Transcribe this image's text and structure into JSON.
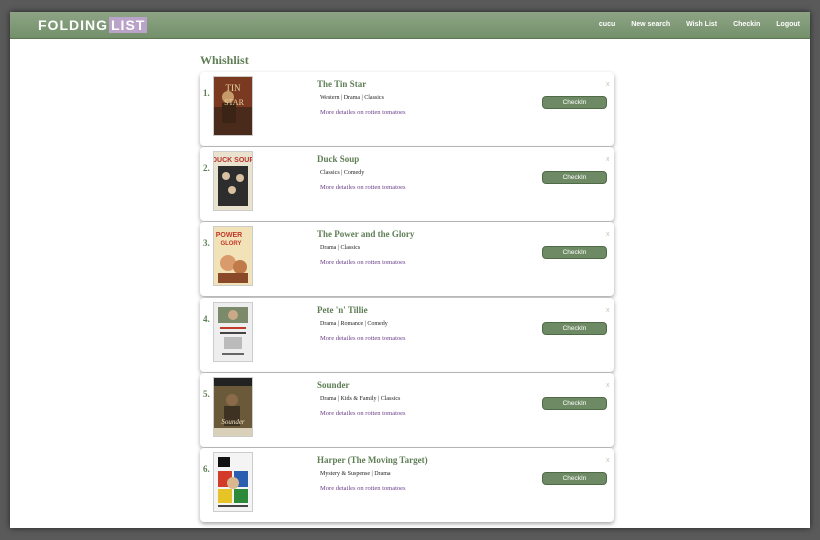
{
  "brand": {
    "part1": "FOLDING",
    "part2": "LIST"
  },
  "nav": {
    "user": "cucu",
    "new_search": "New search",
    "wish_list": "Wish List",
    "checkin": "Checkin",
    "logout": "Logout"
  },
  "page": {
    "title": "Whishlist"
  },
  "items": [
    {
      "rank": "1.",
      "title": "The Tin Star",
      "genres": "Western | Drama | Classics",
      "more": "More detailes on rotten tomatoes",
      "button": "CheckIn",
      "remove": "x"
    },
    {
      "rank": "2.",
      "title": "Duck Soup",
      "genres": "Classics | Comedy",
      "more": "More detailes on rotten tomatoes",
      "button": "CheckIn",
      "remove": "x"
    },
    {
      "rank": "3.",
      "title": "The Power and the Glory",
      "genres": "Drama | Classics",
      "more": "More detailes on rotten tomatoes",
      "button": "CheckIn",
      "remove": "x"
    },
    {
      "rank": "4.",
      "title": "Pete 'n' Tillie",
      "genres": "Drama | Romance | Comedy",
      "more": "More detailes on rotten tomatoes",
      "button": "CheckIn",
      "remove": "x"
    },
    {
      "rank": "5.",
      "title": "Sounder",
      "genres": "Drama | Kids & Family | Classics",
      "more": "More detailes on rotten tomatoes",
      "button": "CheckIn",
      "remove": "x"
    },
    {
      "rank": "6.",
      "title": "Harper (The Moving Target)",
      "genres": "Mystery & Suspense | Drama",
      "more": "More detailes on rotten tomatoes",
      "button": "CheckIn",
      "remove": "x"
    }
  ]
}
